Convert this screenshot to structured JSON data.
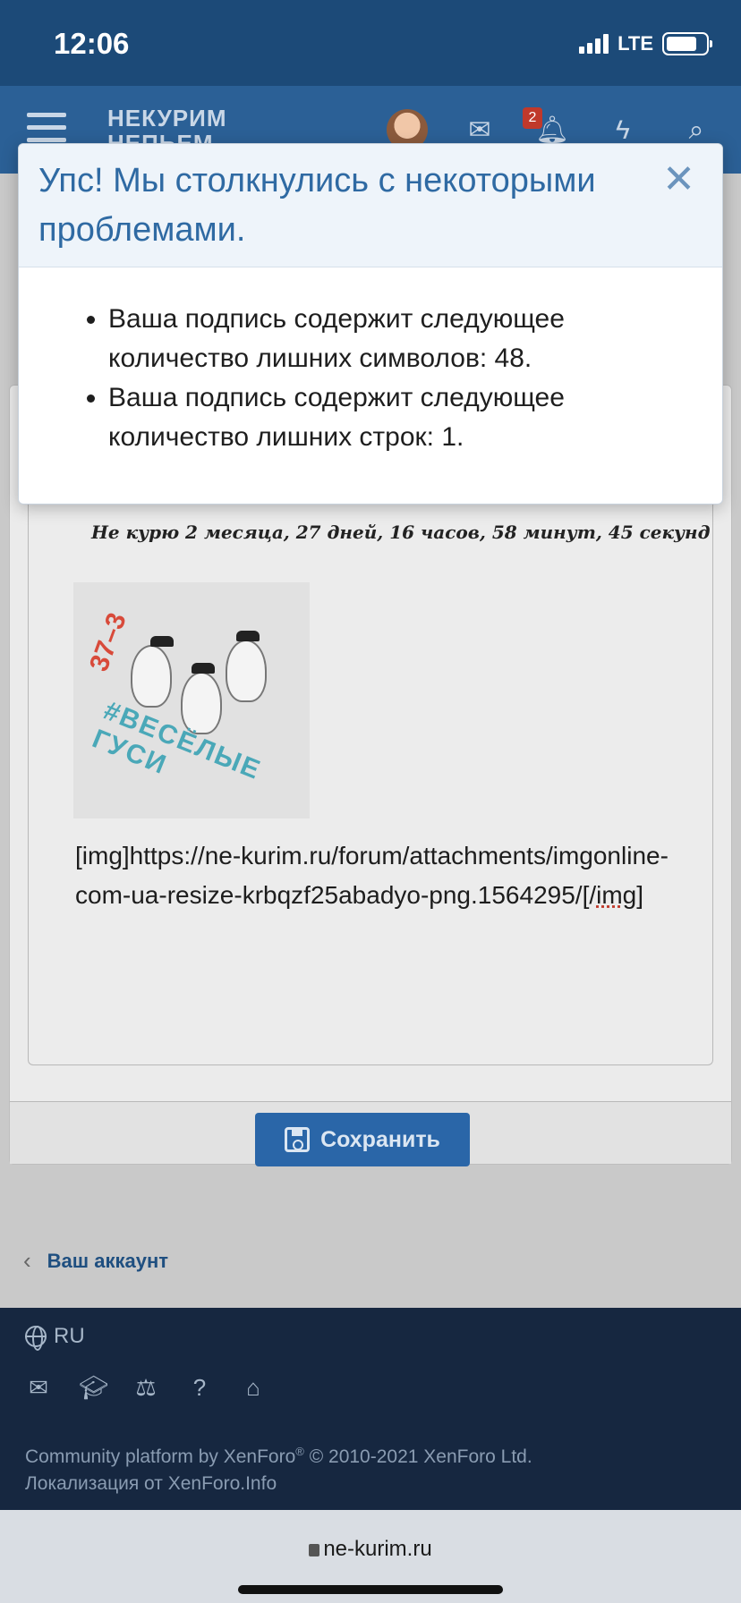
{
  "status_bar": {
    "time": "12:06",
    "network": "LTE"
  },
  "header": {
    "logo_line1": "НЕКУРИМ",
    "logo_line2": "НЕПЬЕМ",
    "notification_count": "2"
  },
  "error_dialog": {
    "title": "Упс! Мы столкнулись с некоторыми проблемами.",
    "close_glyph": "✕",
    "errors": [
      "Ваша подпись содержит следующее количество лишних символов: 48.",
      "Ваша подпись содержит следующее количество лишних строк: 1."
    ]
  },
  "signature": {
    "quit_counter": "Не курю 2 месяца, 27 дней, 16 часов, 58 минут, 45 секунд",
    "geese_caption": "#ВЕСЁЛЫЕ ГУСИ",
    "geese_number": "37–3",
    "img_bbcode_prefix": "[img]https://ne-kurim.ru/forum/attachments/imgonline-com-ua-resize-krbqzf25abadyo-png.1564295/[/",
    "img_bbcode_tag": "img",
    "img_bbcode_suffix": "]"
  },
  "form": {
    "save_label": "Сохранить"
  },
  "nav": {
    "back_label": "Ваш аккаунт"
  },
  "footer": {
    "language": "RU",
    "copyright_line1_a": "Community platform by XenForo",
    "copyright_line1_sup": "®",
    "copyright_line1_b": " © 2010-2021 XenForo Ltd.",
    "copyright_line2": "Локализация от XenForo.Info"
  },
  "browser": {
    "url": "ne-kurim.ru"
  },
  "colors": {
    "header_bg": "#2b6096",
    "status_bg": "#1c4a78",
    "accent": "#2f6aa3",
    "footer_bg": "#162740"
  }
}
